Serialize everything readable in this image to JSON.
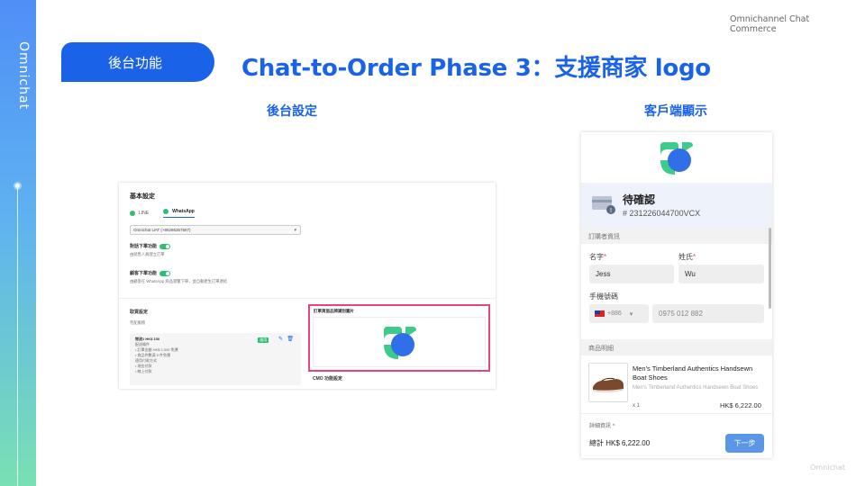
{
  "brand": {
    "rail_text": "Omnichat",
    "top_right": "Omnichannel Chat Commerce",
    "watermark": "Omnichat"
  },
  "header": {
    "section": "後台功能",
    "title": "Chat-to-Order Phase 3：支援商家 logo"
  },
  "columns": {
    "left": "後台設定",
    "right": "客戶端顯示"
  },
  "colors": {
    "brand_blue": "#1a63e8",
    "highlight_pink": "#e8457a",
    "logo_green": "#3ccb8a",
    "logo_blue": "#2f6fe8"
  },
  "admin": {
    "heading": "基本設定",
    "tabs": [
      "LINE",
      "WhatsApp"
    ],
    "active_tab": "WhatsApp",
    "channel_select": "Omnichat UAT (+85295367587)",
    "setting1_title": "對話下單功能",
    "setting1_desc": "由銷售人員建立訂單",
    "setting2_title": "顧客下單功能",
    "setting2_desc": "由顧客在 WhatsApp 商品瀏覽下單，並自動產生訂單連結",
    "delivery_title": "取貨設定",
    "delivery_sub": "宅配服務",
    "card_line1": "物流1   HK$ 150",
    "card_line2": "配送條件",
    "card_line3": "• 訂單金額 HK$ 2,000 免運",
    "card_line4": "• 商品件數滿 5 件免運",
    "card_line5": "適用付款方式",
    "card_line6": "• 現金付款",
    "card_line7": "• 線上付款",
    "card_badge": "啟用",
    "logo_label": "訂單頁面品牌識別圖片",
    "cmo_label": "CMO 功能設定"
  },
  "phone": {
    "status_title": "待確認",
    "order_number": "# 231226044700VCX",
    "buyer_section": "訂購者資訊",
    "first_name_label": "名字",
    "first_name": "Jess",
    "last_name_label": "姓氏",
    "last_name": "Wu",
    "phone_label": "手機號碼",
    "country_code": "+886",
    "phone_number": "0975 012 882",
    "product_section": "商品明細",
    "product_name": "Men's Timberland Authentics Handsewn Boat Shoes",
    "product_sub": "Men's Timberland Authentics Handsewn Boat Shoes",
    "quantity": "x 1",
    "price": "HK$ 6,222.00",
    "detail_link": "詳細資訊 ^",
    "total": "總計  HK$ 6,222.00",
    "next_button": "下一步"
  }
}
